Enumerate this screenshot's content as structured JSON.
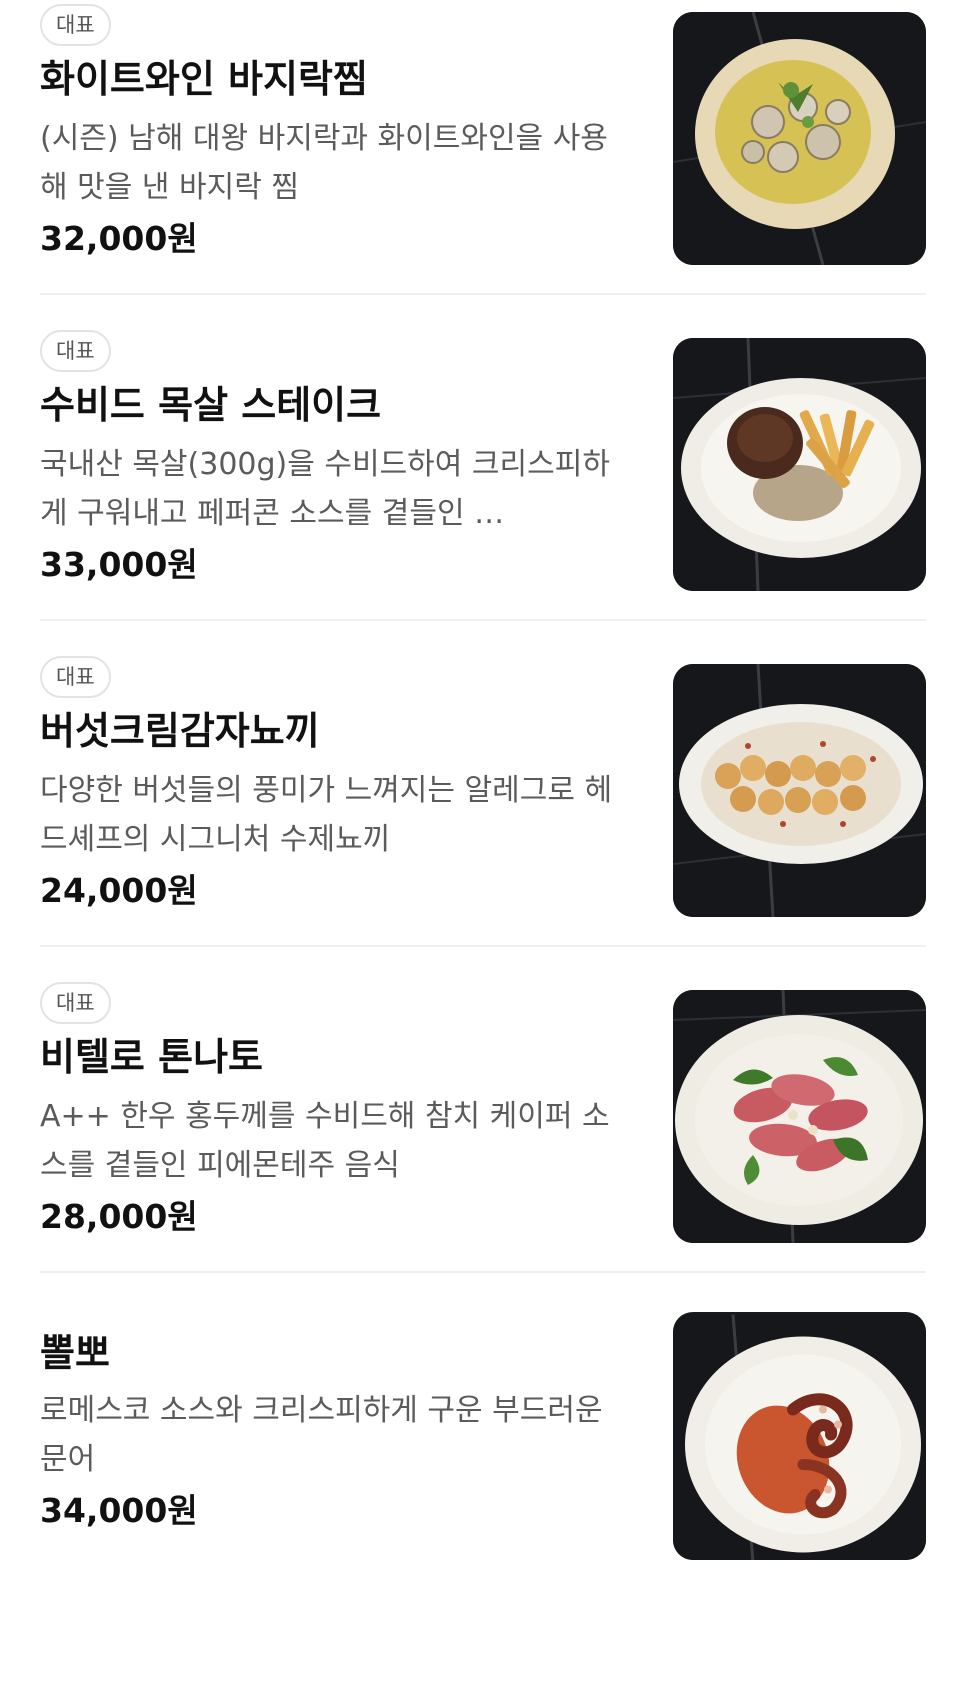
{
  "menu": {
    "items": [
      {
        "badge": "대표",
        "name": "화이트와인 바지락찜",
        "description": "(시즌) 남해 대왕 바지락과 화이트와인을 사용해 맛을 낸 바지락 찜",
        "price": "32,000원",
        "image_icon": "clams-dish-photo"
      },
      {
        "badge": "대표",
        "name": "수비드 목살 스테이크",
        "description": "국내산 목살(300g)을 수비드하여 크리스피하게 구워내고 페퍼콘 소스를 곁들인 …",
        "price": "33,000원",
        "image_icon": "steak-dish-photo"
      },
      {
        "badge": "대표",
        "name": "버섯크림감자뇨끼",
        "description": "다양한 버섯들의 풍미가 느껴지는 알레그로 헤드셰프의 시그니처 수제뇨끼",
        "price": "24,000원",
        "image_icon": "gnocchi-dish-photo"
      },
      {
        "badge": "대표",
        "name": "비텔로 톤나토",
        "description": "A++ 한우 홍두께를 수비드해 참치 케이퍼 소스를 곁들인 피에몬테주 음식",
        "price": "28,000원",
        "image_icon": "vitello-tonnato-dish-photo"
      },
      {
        "name": "뽈뽀",
        "description": "로메스코 소스와 크리스피하게 구운 부드러운 문어",
        "price": "34,000원",
        "image_icon": "octopus-dish-photo"
      }
    ]
  }
}
